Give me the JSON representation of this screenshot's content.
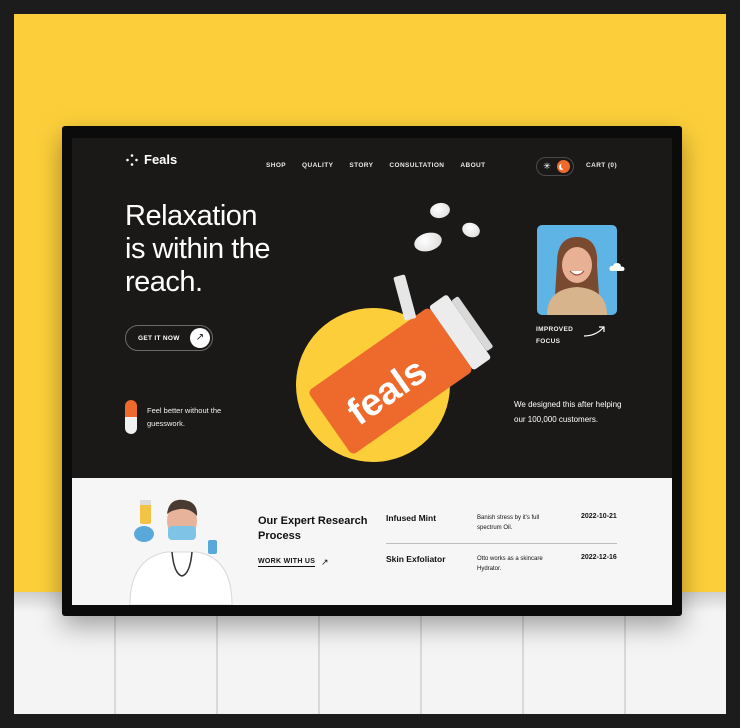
{
  "brand": {
    "name": "Feals"
  },
  "nav": {
    "items": [
      "SHOP",
      "QUALITY",
      "STORY",
      "CONSULTATION",
      "ABOUT"
    ],
    "cart": "CART (0)",
    "theme_toggle": {
      "light_icon": "sun-icon",
      "dark_icon": "moon-icon",
      "active": "dark"
    }
  },
  "hero": {
    "headline_lines": [
      "Relaxation",
      "is within the",
      "reach."
    ],
    "cta_label": "GET IT NOW",
    "feel_text": "Feel better without the guesswork.",
    "product_brand": "feals",
    "improved_label": "IMPROVED FOCUS",
    "designed_text": "We designed this after helping our 100,000 customers."
  },
  "research": {
    "title": "Our Expert Research Process",
    "link_label": "WORK WITH US",
    "products": [
      {
        "name": "Infused Mint",
        "description": "Banish stress by it's full spectrum Oil.",
        "date": "2022-10-21"
      },
      {
        "name": "Skin Exfoliator",
        "description": "Otto works as a skincare Hydrator.",
        "date": "2022-12-16"
      }
    ]
  },
  "colors": {
    "wall": "#fccf3a",
    "screen_dark": "#1b1918",
    "accent_orange": "#ee6a2c",
    "accent_yellow": "#fccf3a",
    "portrait_bg": "#5fb4e6",
    "lower_bg": "#f6f6f6"
  }
}
